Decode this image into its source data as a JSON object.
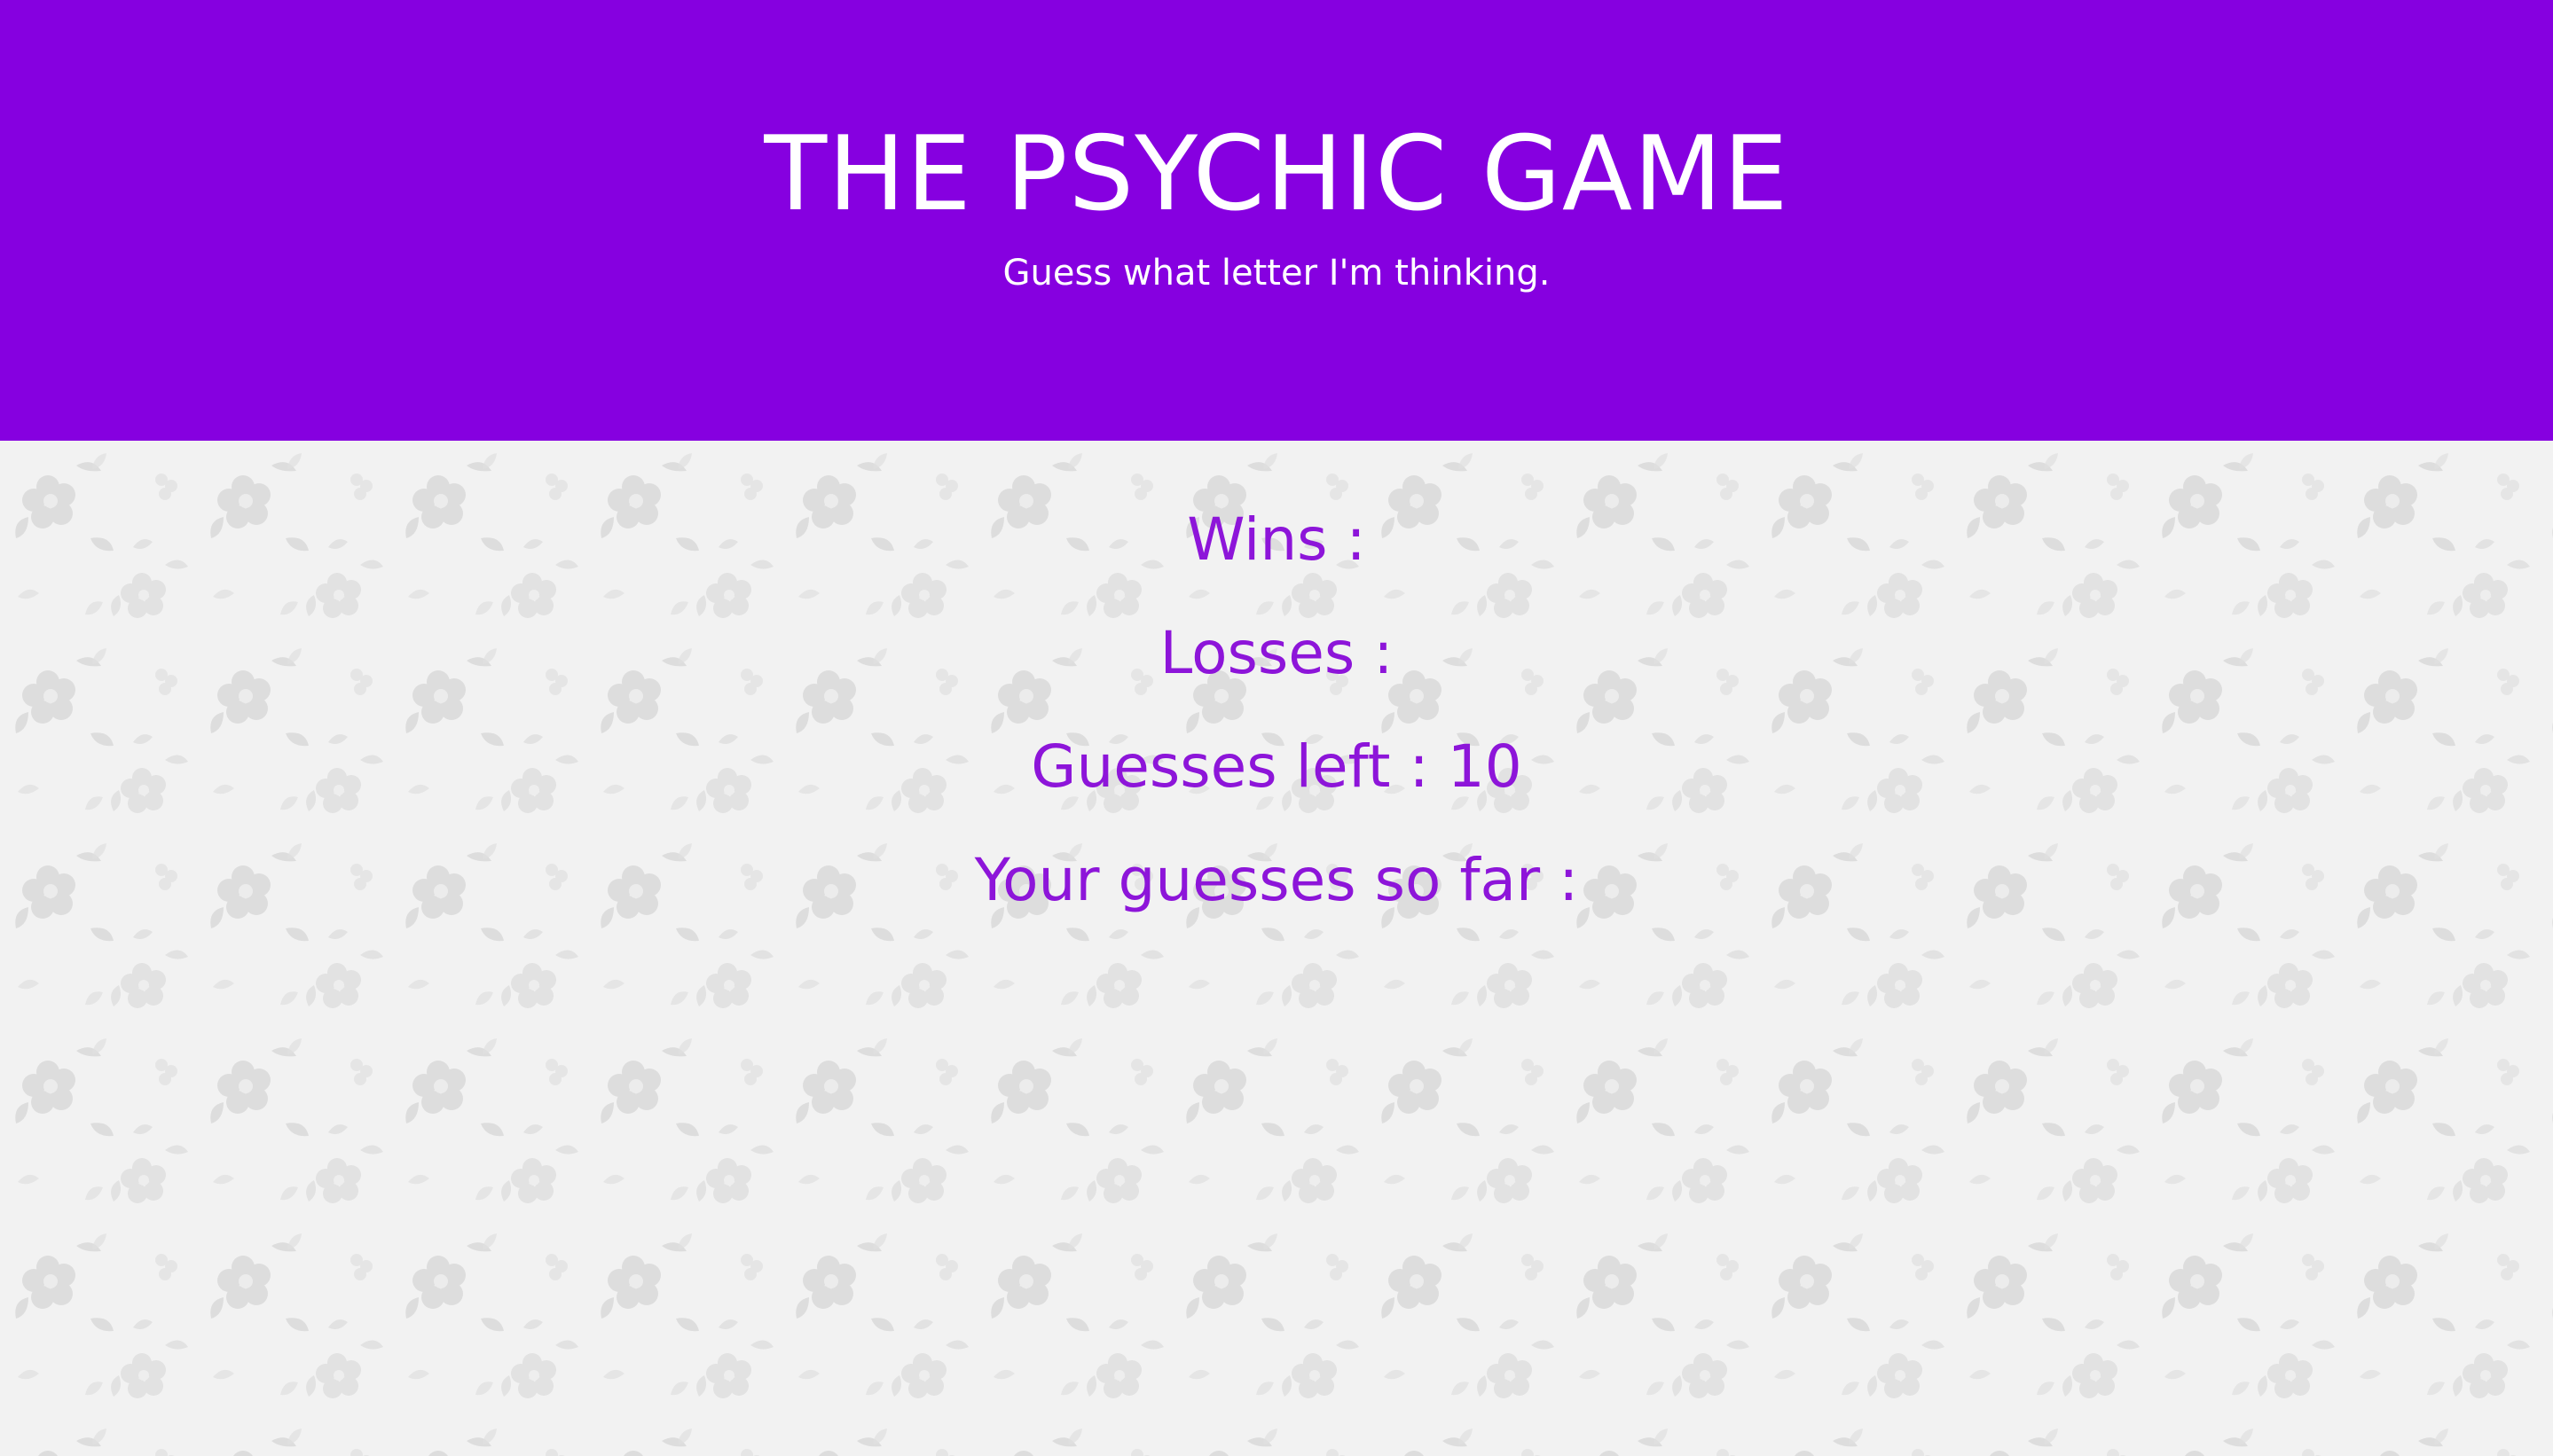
{
  "header": {
    "title": "THE PSYCHIC GAME",
    "subtitle": "Guess what letter I'm thinking."
  },
  "stats": {
    "wins_label": "Wins :",
    "wins_value": "",
    "losses_label": "Losses :",
    "losses_value": "",
    "guesses_left_label": "Guesses left :",
    "guesses_left_value": "10",
    "guesses_so_far_label": "Your guesses so far :",
    "guesses_so_far_value": ""
  },
  "colors": {
    "header_background": "#8600e0",
    "header_text": "#ffffff",
    "stat_text": "#8d15d9",
    "page_background": "#f2f2f2",
    "floral_pattern": "#d8d8d8"
  },
  "background": {
    "pattern": "floral-wallpaper"
  }
}
